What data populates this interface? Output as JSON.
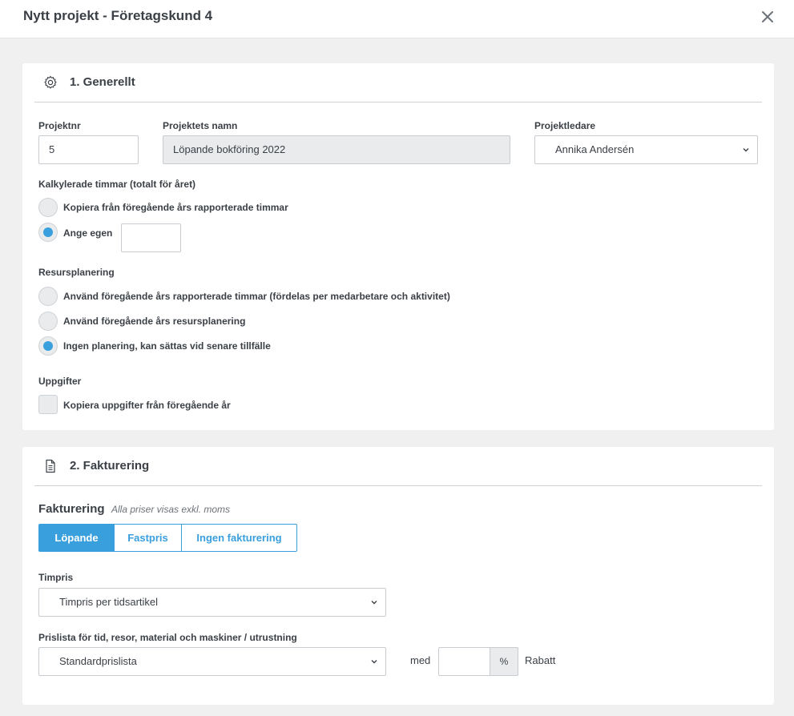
{
  "modal": {
    "title": "Nytt projekt - Företagskund 4"
  },
  "general": {
    "title": "1. Generellt",
    "project_nr": {
      "label": "Projektnr",
      "value": "5"
    },
    "project_name": {
      "label": "Projektets namn",
      "value": "Löpande bokföring 2022"
    },
    "project_lead": {
      "label": "Projektledare",
      "value": "Annika Andersén"
    },
    "hours": {
      "label": "Kalkylerade timmar (totalt för året)",
      "options": [
        {
          "label": "Kopiera från föregående års rapporterade timmar",
          "checked": false
        },
        {
          "label": "Ange egen",
          "checked": true
        }
      ],
      "own_value": ""
    },
    "resource": {
      "label": "Resursplanering",
      "options": [
        {
          "label": "Använd föregående års rapporterade timmar  (fördelas per medarbetare och aktivitet)",
          "checked": false
        },
        {
          "label": "Använd föregående års resursplanering",
          "checked": false
        },
        {
          "label": "Ingen planering, kan sättas vid senare tillfälle",
          "checked": true
        }
      ]
    },
    "tasks": {
      "label": "Uppgifter",
      "checkbox_label": "Kopiera uppgifter från föregående år",
      "checked": false
    }
  },
  "billing": {
    "title": "2. Fakturering",
    "heading": "Fakturering",
    "subheading": "Alla priser visas exkl. moms",
    "modes": [
      {
        "label": "Löpande",
        "active": true
      },
      {
        "label": "Fastpris",
        "active": false
      },
      {
        "label": "Ingen fakturering",
        "active": false
      }
    ],
    "rate": {
      "label": "Timpris",
      "value": "Timpris per tidsartikel"
    },
    "pricelist": {
      "label": "Prislista för tid, resor, material och maskiner / utrustning",
      "value": "Standardprislista",
      "with_label": "med",
      "discount_value": "",
      "percent_label": "%",
      "discount_label": "Rabatt"
    }
  },
  "colors": {
    "accent": "#3a9fdd",
    "background": "#f0f0f0",
    "border": "#c8ccd0"
  },
  "icons": {
    "close": "close-icon",
    "settings": "gear-icon",
    "document": "document-icon",
    "chevron": "chevron-down-icon"
  }
}
